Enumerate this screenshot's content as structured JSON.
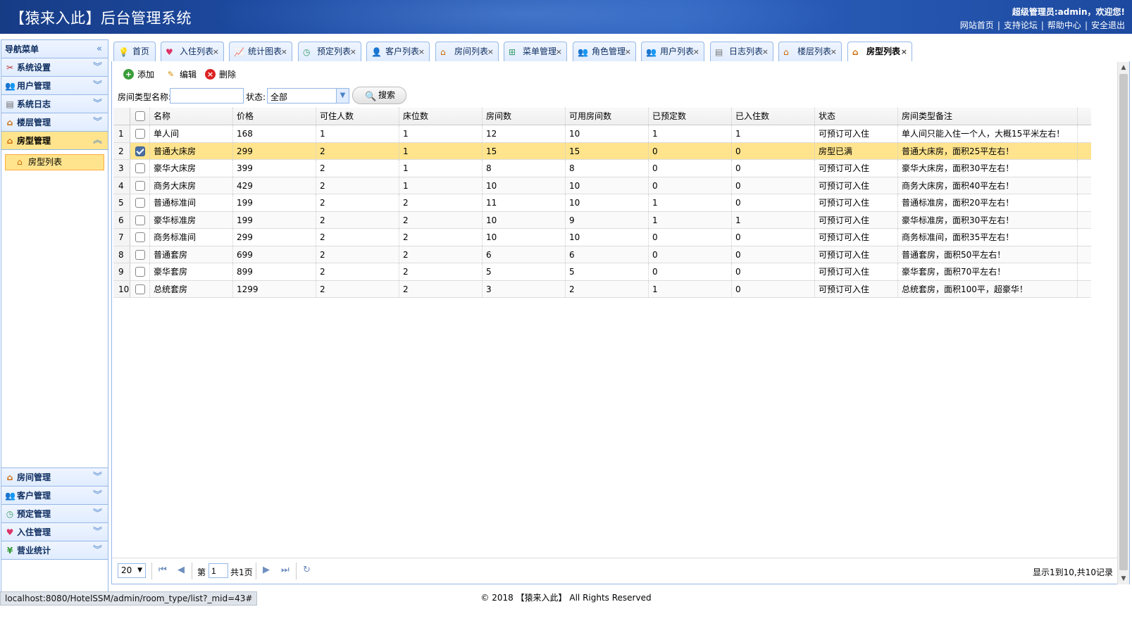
{
  "header": {
    "title": "【猿来入此】后台管理系统",
    "user_line": "超级管理员:admin，欢迎您!",
    "links": [
      "网站首页",
      "支持论坛",
      "帮助中心",
      "安全退出"
    ]
  },
  "sidebar": {
    "title": "导航菜单",
    "collapse_icon": "«",
    "top_groups": [
      {
        "label": "系统设置",
        "icon": "tools-icon"
      },
      {
        "label": "用户管理",
        "icon": "users-icon"
      },
      {
        "label": "系统日志",
        "icon": "log-icon"
      },
      {
        "label": "楼层管理",
        "icon": "house-icon"
      },
      {
        "label": "房型管理",
        "icon": "house-icon"
      }
    ],
    "active_sub_item": "房型列表",
    "bottom_groups": [
      {
        "label": "房间管理",
        "icon": "house-icon"
      },
      {
        "label": "客户管理",
        "icon": "users-icon"
      },
      {
        "label": "预定管理",
        "icon": "clock-icon"
      },
      {
        "label": "入住管理",
        "icon": "heart-icon"
      },
      {
        "label": "营业统计",
        "icon": "yen-icon"
      }
    ]
  },
  "tabs": [
    "首页",
    "入住列表",
    "统计图表",
    "预定列表",
    "客户列表",
    "房间列表",
    "菜单管理",
    "角色管理",
    "用户列表",
    "日志列表",
    "楼层列表",
    "房型列表"
  ],
  "toolbar": {
    "add": "添加",
    "edit": "编辑",
    "delete": "删除"
  },
  "search": {
    "name_label": "房间类型名称:",
    "name_value": "",
    "status_label": "状态:",
    "status_value": "全部",
    "button": "搜索"
  },
  "grid": {
    "columns": [
      "名称",
      "价格",
      "可住人数",
      "床位数",
      "房间数",
      "可用房间数",
      "已预定数",
      "已入住数",
      "状态",
      "房间类型备注"
    ],
    "rows": [
      {
        "n": "1",
        "c": [
          "单人间",
          "168",
          "1",
          "1",
          "12",
          "10",
          "1",
          "1",
          "可预订可入住",
          "单人间只能入住一个人，大概15平米左右！"
        ]
      },
      {
        "n": "2",
        "c": [
          "普通大床房",
          "299",
          "2",
          "1",
          "15",
          "15",
          "0",
          "0",
          "房型已满",
          "普通大床房，面积25平左右！"
        ]
      },
      {
        "n": "3",
        "c": [
          "豪华大床房",
          "399",
          "2",
          "1",
          "8",
          "8",
          "0",
          "0",
          "可预订可入住",
          "豪华大床房，面积30平左右！"
        ]
      },
      {
        "n": "4",
        "c": [
          "商务大床房",
          "429",
          "2",
          "1",
          "10",
          "10",
          "0",
          "0",
          "可预订可入住",
          "商务大床房，面积40平左右！"
        ]
      },
      {
        "n": "5",
        "c": [
          "普通标准间",
          "199",
          "2",
          "2",
          "11",
          "10",
          "1",
          "0",
          "可预订可入住",
          "普通标准房，面积20平左右！"
        ]
      },
      {
        "n": "6",
        "c": [
          "豪华标准房",
          "199",
          "2",
          "2",
          "10",
          "9",
          "1",
          "1",
          "可预订可入住",
          "豪华标准房，面积30平左右！"
        ]
      },
      {
        "n": "7",
        "c": [
          "商务标准间",
          "299",
          "2",
          "2",
          "10",
          "10",
          "0",
          "0",
          "可预订可入住",
          "商务标准间，面积35平左右！"
        ]
      },
      {
        "n": "8",
        "c": [
          "普通套房",
          "699",
          "2",
          "2",
          "6",
          "6",
          "0",
          "0",
          "可预订可入住",
          "普通套房，面积50平左右！"
        ]
      },
      {
        "n": "9",
        "c": [
          "豪华套房",
          "899",
          "2",
          "2",
          "5",
          "5",
          "0",
          "0",
          "可预订可入住",
          "豪华套房，面积70平左右！"
        ]
      },
      {
        "n": "10",
        "c": [
          "总统套房",
          "1299",
          "2",
          "2",
          "3",
          "2",
          "1",
          "0",
          "可预订可入住",
          "总统套房，面积100平，超豪华！"
        ]
      }
    ],
    "selected_row": 2
  },
  "pager": {
    "page_size": "20",
    "page_prefix": "第",
    "page_value": "1",
    "page_suffix": "共1页",
    "info": "显示1到10,共10记录"
  },
  "footer": "© 2018 【猿来入此】 All Rights Reserved",
  "status_url": "localhost:8080/HotelSSM/admin/room_type/list?_mid=43#",
  "colors": {
    "accent": "#95b8e7",
    "selected": "#ffe48d",
    "header": "#1f4ea8"
  }
}
